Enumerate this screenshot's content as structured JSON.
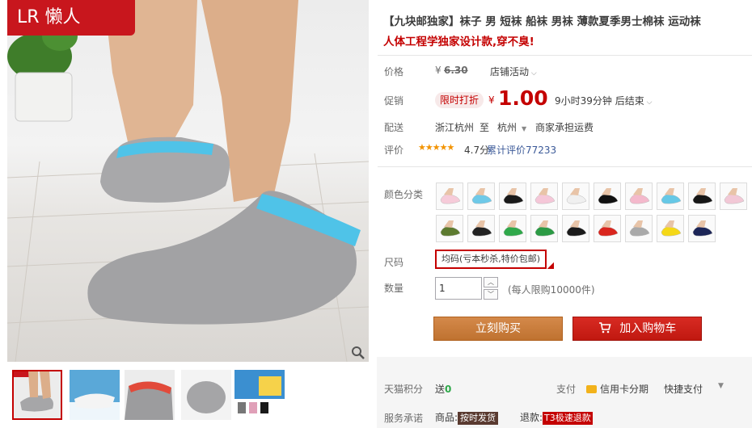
{
  "gallery": {
    "brand": "LR 懒人",
    "thumbnails": [
      "thumb-1",
      "thumb-2",
      "thumb-3",
      "thumb-4",
      "thumb-5"
    ]
  },
  "product": {
    "title": "【九块邮独家】袜子 男 短袜 船袜 男袜 薄款夏季男士棉袜 运动袜",
    "subtitle": "人体工程学独家设计款,穿不臭!"
  },
  "price": {
    "label": "价格",
    "currency": "¥",
    "original": "6.30",
    "shop_activity": "店铺活动"
  },
  "promo": {
    "label": "促销",
    "tag": "限时打折",
    "currency": "¥",
    "price": "1.00",
    "countdown": "9小时39分钟 后结束"
  },
  "delivery": {
    "label": "配送",
    "from": "浙江杭州",
    "to_word": "至",
    "to": "杭州",
    "fee": "商家承担运费"
  },
  "rating": {
    "label": "评价",
    "stars": "★★★★★",
    "score": "4.7分",
    "reviews": "累计评价77233"
  },
  "color": {
    "label": "颜色分类",
    "swatches": [
      "#f6cbd9",
      "#6ec9e8",
      "#1a1a1a",
      "#f5c7d8",
      "#f0f0f0",
      "#111111",
      "#f4b9cc",
      "#66c8e6",
      "#161616",
      "#f2c8d6",
      "#5c7a2f",
      "#222222",
      "#2fa84a",
      "#2b9a44",
      "#1a1a1a",
      "#d9251d",
      "#a9a9a9",
      "#f5d817",
      "#1c2557"
    ]
  },
  "size": {
    "label": "尺码",
    "option": "均码(亏本秒杀,特价包邮)"
  },
  "quantity": {
    "label": "数量",
    "value": "1",
    "limit": "(每人限购10000件)"
  },
  "actions": {
    "buy": "立刻购买",
    "cart": "加入购物车"
  },
  "footer": {
    "points_label": "天猫积分",
    "points_prefix": "送",
    "points_value": "0",
    "pay_label": "支付",
    "pay_method": "信用卡分期",
    "pay_fast": "快捷支付",
    "promise_label": "服务承诺",
    "goods_label": "商品:",
    "goods_tag": "按时发货",
    "return_label": "退款:",
    "return_tag": "T3极速退款"
  },
  "colors": {
    "accent": "#c40000",
    "buy": "#c87b3a",
    "cart": "#d02018"
  }
}
